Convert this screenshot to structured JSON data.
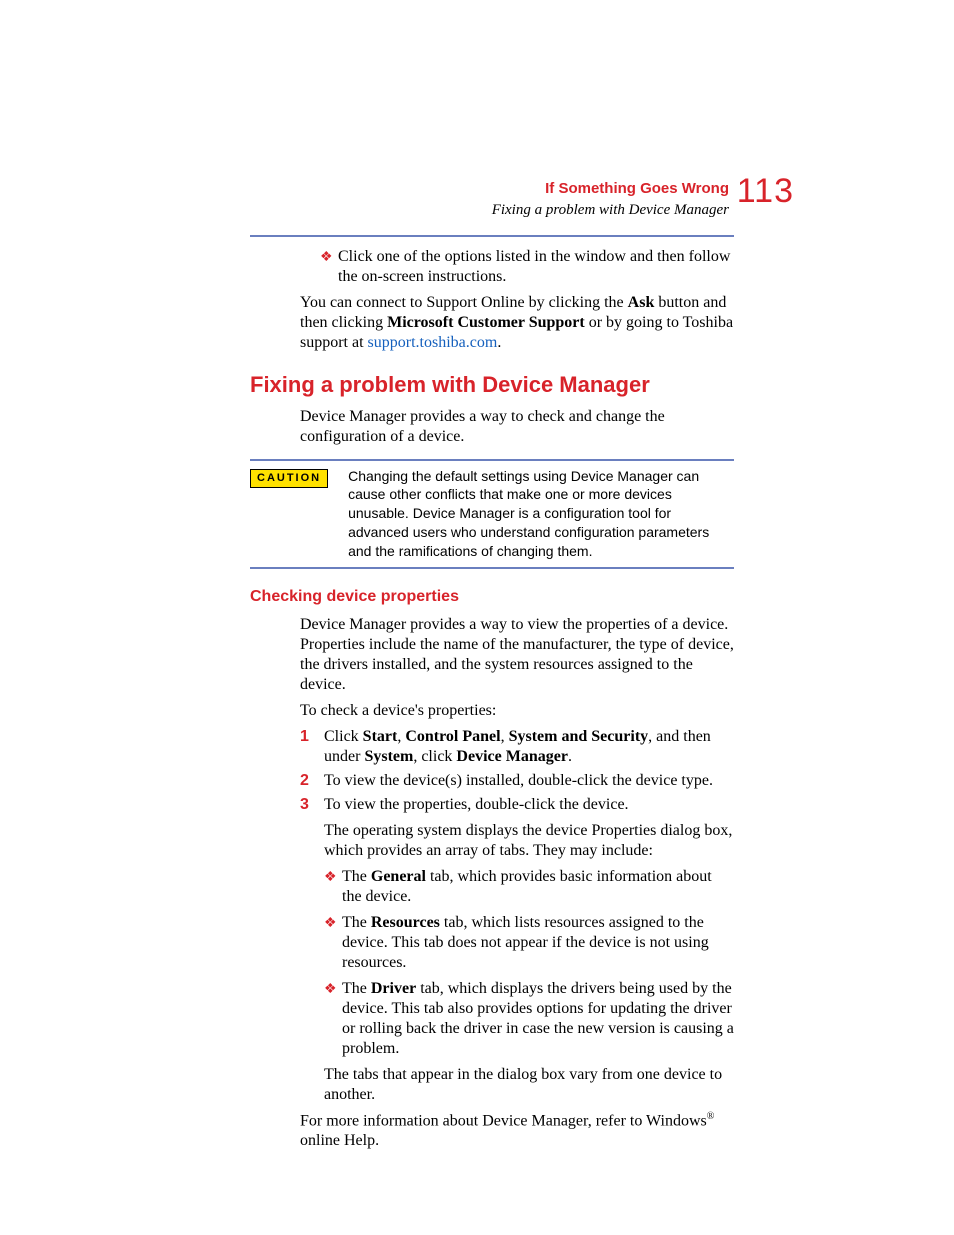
{
  "header": {
    "chapter": "If Something Goes Wrong",
    "section": "Fixing a problem with Device Manager",
    "page_number": "113"
  },
  "intro_bullet": "Click one of the options listed in the window and then follow the on-screen instructions.",
  "intro_para_1": "You can connect to Support Online by clicking the ",
  "intro_bold_ask": "Ask",
  "intro_para_2": " button and then clicking ",
  "intro_bold_mcs": "Microsoft Customer Support",
  "intro_para_3": " or by going to Toshiba support at ",
  "intro_link": "support.toshiba.com",
  "intro_para_4": ".",
  "h1": "Fixing a problem with Device Manager",
  "h1_para": "Device Manager provides a way to check and change the configuration of a device.",
  "caution_label": "CAUTION",
  "caution_text": "Changing the default settings using Device Manager can cause other conflicts that make one or more devices unusable. Device Manager is a configuration tool for advanced users who understand configuration parameters and the ramifications of changing them.",
  "h2": "Checking device properties",
  "h2_para1": "Device Manager provides a way to view the properties of a device. Properties include the name of the manufacturer, the type of device, the drivers installed, and the system resources assigned to the device.",
  "h2_para2": "To check a device's properties:",
  "steps": [
    {
      "num": "1",
      "pre": "Click ",
      "b1": "Start",
      "s1": ", ",
      "b2": "Control Panel",
      "s2": ", ",
      "b3": "System and Security",
      "s3": ", and then under ",
      "b4": "System",
      "s4": ", click ",
      "b5": "Device Manager",
      "s5": "."
    },
    {
      "num": "2",
      "text": "To view the device(s) installed, double-click the device type."
    },
    {
      "num": "3",
      "text": "To view the properties, double-click the device."
    }
  ],
  "after_step3": "The operating system displays the device Properties dialog box, which provides an array of tabs. They may include:",
  "tabs": [
    {
      "pre": "The ",
      "b": "General",
      "post": " tab, which provides basic information about the device."
    },
    {
      "pre": "The ",
      "b": "Resources",
      "post": " tab, which lists resources assigned to the device. This tab does not appear if the device is not using resources."
    },
    {
      "pre": "The ",
      "b": "Driver",
      "post": " tab, which displays the drivers being used by the device. This tab also provides options for updating the driver or rolling back the driver in case the new version is causing a problem."
    }
  ],
  "tabs_after": "The tabs that appear in the dialog box vary from one device to another.",
  "final_para_1": "For more information about Device Manager, refer to Windows",
  "final_reg": "®",
  "final_para_2": " online Help."
}
